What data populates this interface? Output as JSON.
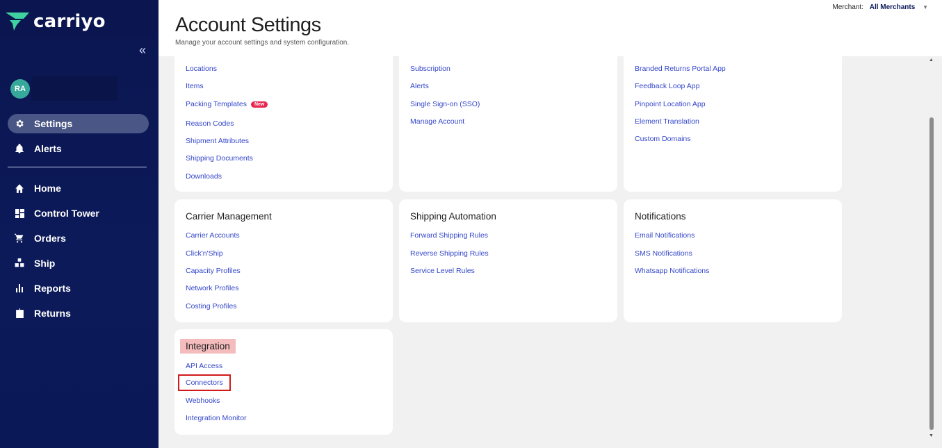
{
  "brand": {
    "name": "carriyo"
  },
  "user": {
    "initials": "RA"
  },
  "sidebar": {
    "top_items": [
      {
        "label": "Settings",
        "icon": "gear-icon",
        "active": true
      },
      {
        "label": "Alerts",
        "icon": "bell-icon",
        "active": false
      }
    ],
    "main_items": [
      {
        "label": "Home",
        "icon": "home-icon"
      },
      {
        "label": "Control Tower",
        "icon": "dashboard-icon"
      },
      {
        "label": "Orders",
        "icon": "cart-icon"
      },
      {
        "label": "Ship",
        "icon": "boxes-icon"
      },
      {
        "label": "Reports",
        "icon": "bar-chart-icon"
      },
      {
        "label": "Returns",
        "icon": "return-box-icon"
      }
    ]
  },
  "header": {
    "title": "Account Settings",
    "subtitle": "Manage your account settings and system configuration.",
    "merchant_label": "Merchant:",
    "merchant_value": "All Merchants"
  },
  "cards": {
    "col1_top": {
      "links": [
        "Locations",
        "Items",
        "Packing Templates",
        "Reason Codes",
        "Shipment Attributes",
        "Shipping Documents",
        "Downloads"
      ],
      "badge": "New"
    },
    "col2_top": {
      "links": [
        "Subscription",
        "Alerts",
        "Single Sign-on (SSO)",
        "Manage Account"
      ]
    },
    "col3_top": {
      "links": [
        "Branded Returns Portal App",
        "Feedback Loop App",
        "Pinpoint Location App",
        "Element Translation",
        "Custom Domains"
      ]
    },
    "carrier": {
      "title": "Carrier Management",
      "links": [
        "Carrier Accounts",
        "Click'n'Ship",
        "Capacity Profiles",
        "Network Profiles",
        "Costing Profiles"
      ]
    },
    "shipping": {
      "title": "Shipping Automation",
      "links": [
        "Forward Shipping Rules",
        "Reverse Shipping Rules",
        "Service Level Rules"
      ]
    },
    "notifications": {
      "title": "Notifications",
      "links": [
        "Email Notifications",
        "SMS Notifications",
        "Whatsapp Notifications"
      ]
    },
    "integration": {
      "title": "Integration",
      "links": [
        "API Access",
        "Connectors",
        "Webhooks",
        "Integration Monitor"
      ]
    }
  },
  "colors": {
    "sidebar_bg": "#0c1a5a",
    "link": "#3447c9",
    "highlight": "#f4bcbc",
    "badge": "#e8264f",
    "focus_box": "#d11a1a"
  }
}
